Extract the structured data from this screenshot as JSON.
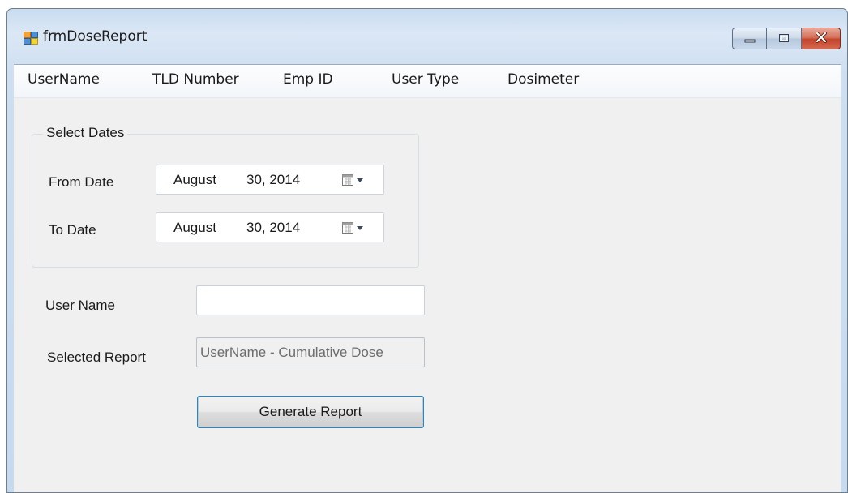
{
  "window": {
    "title": "frmDoseReport",
    "icon": "windows-form-icon"
  },
  "caption_buttons": {
    "minimize_icon": "minimize-icon",
    "maximize_icon": "maximize-icon",
    "close_icon": "close-icon"
  },
  "menu": {
    "items": [
      "UserName",
      "TLD Number",
      "Emp ID",
      "User Type",
      "Dosimeter"
    ]
  },
  "select_dates": {
    "legend": "Select Dates",
    "from_label": "From Date",
    "from_month": "August",
    "from_daymonth": "30, 2014",
    "to_label": "To Date",
    "to_month": "August",
    "to_daymonth": "30, 2014",
    "calendar_icon": "calendar-dropdown-icon"
  },
  "form": {
    "user_name_label": "User Name",
    "user_name_value": "",
    "selected_report_label": "Selected Report",
    "selected_report_value": "UserName - Cumulative Dose",
    "generate_button": "Generate Report"
  },
  "colors": {
    "title_bar": "#dbe7f5",
    "close_button": "#c3432b",
    "client_bg": "#f0f0f0",
    "button_focus_border": "#3c7fb1"
  }
}
